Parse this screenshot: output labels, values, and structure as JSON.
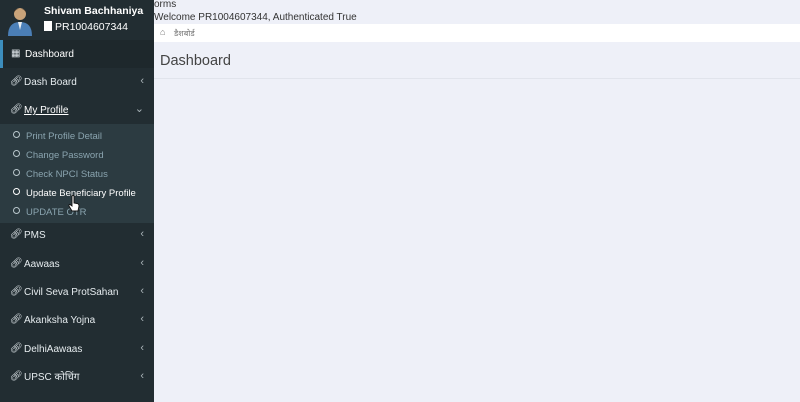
{
  "user": {
    "name": "Shivam Bachhaniya",
    "id": "PR1004607344"
  },
  "header": {
    "forms_text": "orms",
    "welcome_text": "Welcome PR1004607344, Authenticated True"
  },
  "breadcrumb": {
    "home_label": "डैशबोर्ड"
  },
  "page": {
    "title": "Dashboard"
  },
  "sidebar": {
    "items": [
      {
        "label": "Dashboard",
        "icon": "grid-icon"
      },
      {
        "label": "Dash Board",
        "icon": "link-icon"
      },
      {
        "label": "My Profile",
        "icon": "link-icon"
      },
      {
        "label": "PMS",
        "icon": "link-icon"
      },
      {
        "label": "Aawaas",
        "icon": "link-icon"
      },
      {
        "label": "Civil Seva ProtSahan",
        "icon": "link-icon"
      },
      {
        "label": "Akanksha Yojna",
        "icon": "link-icon"
      },
      {
        "label": "DelhiAawaas",
        "icon": "link-icon"
      },
      {
        "label": "UPSC कोचिंग",
        "icon": "link-icon"
      }
    ],
    "submenu": [
      {
        "label": "Print Profile Detail"
      },
      {
        "label": "Change Password"
      },
      {
        "label": "Check NPCI Status"
      },
      {
        "label": "Update Beneficiary Profile"
      },
      {
        "label": "UPDATE OTR"
      }
    ]
  },
  "colors": {
    "sidebar_bg": "#222d32",
    "submenu_bg": "#2c3b41",
    "accent": "#3c8dbc",
    "content_bg": "#eef0f8"
  }
}
